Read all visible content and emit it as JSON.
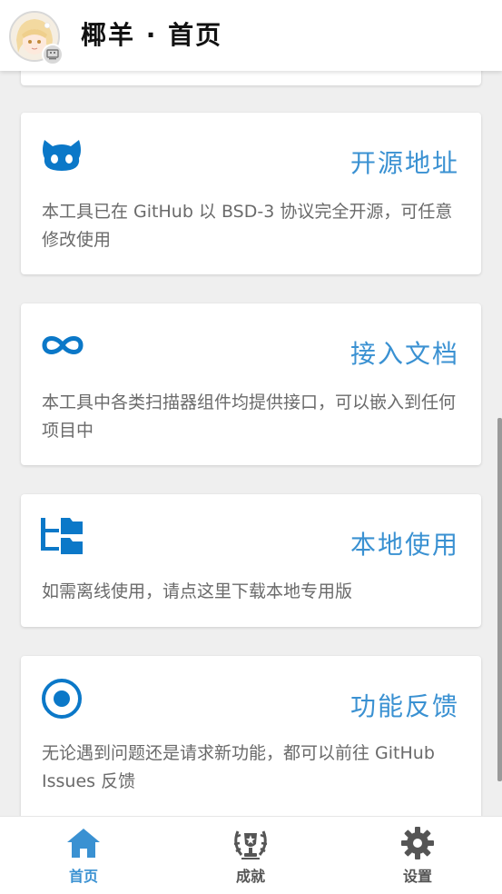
{
  "header": {
    "title": "椰羊 · 首页"
  },
  "cards": [
    {
      "icon": "github-icon",
      "title": "开源地址",
      "desc": "本工具已在 GitHub 以 BSD-3 协议完全开源，可任意修改使用"
    },
    {
      "icon": "infinity-icon",
      "title": "接入文档",
      "desc": "本工具中各类扫描器组件均提供接口，可以嵌入到任何项目中"
    },
    {
      "icon": "folder-tree-icon",
      "title": "本地使用",
      "desc": "如需离线使用，请点这里下载本地专用版"
    },
    {
      "icon": "radio-target-icon",
      "title": "功能反馈",
      "desc": "无论遇到问题还是请求新功能，都可以前往 GitHub Issues 反馈"
    }
  ],
  "nav": [
    {
      "label": "首页",
      "icon": "home-icon",
      "active": true
    },
    {
      "label": "成就",
      "icon": "trophy-wreath-icon",
      "active": false
    },
    {
      "label": "设置",
      "icon": "gear-icon",
      "active": false
    }
  ],
  "colors": {
    "accent": "#3a91d2",
    "icon_blue": "#0b78c8",
    "background": "#efefef",
    "text_gray": "#6a6a6a"
  }
}
